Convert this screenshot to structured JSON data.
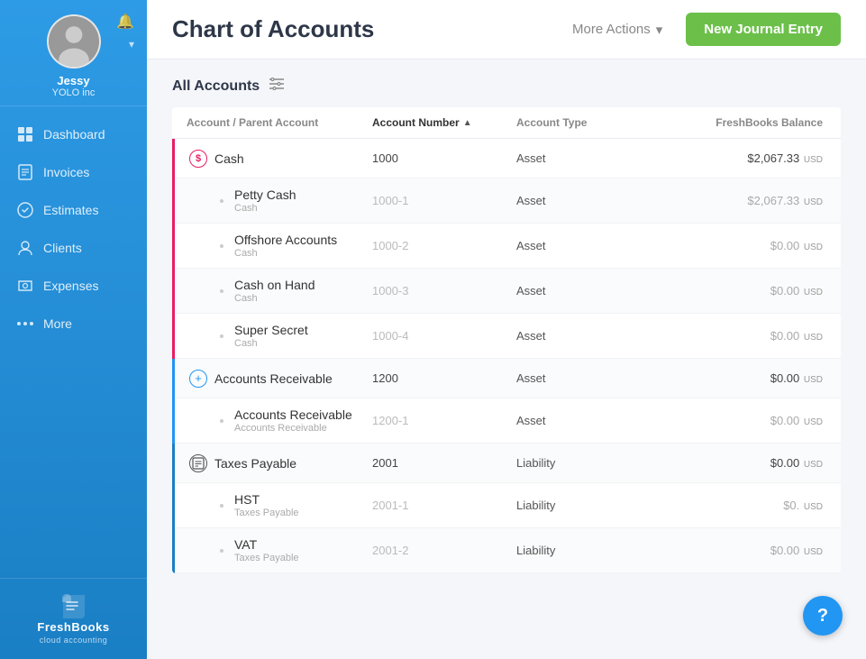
{
  "sidebar": {
    "user": {
      "name": "Jessy",
      "company": "YOLO inc"
    },
    "nav_items": [
      {
        "id": "dashboard",
        "label": "Dashboard",
        "icon": "dashboard"
      },
      {
        "id": "invoices",
        "label": "Invoices",
        "icon": "invoices"
      },
      {
        "id": "estimates",
        "label": "Estimates",
        "icon": "estimates"
      },
      {
        "id": "clients",
        "label": "Clients",
        "icon": "clients"
      },
      {
        "id": "expenses",
        "label": "Expenses",
        "icon": "expenses"
      },
      {
        "id": "more",
        "label": "More",
        "icon": "more"
      }
    ],
    "logo": {
      "text": "FreshBooks",
      "sub": "cloud accounting"
    }
  },
  "header": {
    "title": "Chart of Accounts",
    "more_actions_label": "More Actions",
    "new_journal_label": "New Journal Entry"
  },
  "accounts_section": {
    "all_accounts_label": "All Accounts",
    "table_headers": {
      "account": "Account / Parent Account",
      "number": "Account Number",
      "type": "Account Type",
      "balance": "FreshBooks Balance"
    },
    "rows": [
      {
        "id": "cash",
        "name": "Cash",
        "icon": "dollar",
        "number": "1000",
        "type": "Asset",
        "balance": "$2,067.33",
        "currency": "USD",
        "indent": 0,
        "accent": "pink"
      },
      {
        "id": "petty-cash",
        "name": "Petty Cash",
        "sub": "Cash",
        "icon": "indent",
        "number": "1000-1",
        "type": "Asset",
        "balance": "$2,067.33",
        "currency": "USD",
        "indent": 1,
        "accent": "pink"
      },
      {
        "id": "offshore",
        "name": "Offshore Accounts",
        "sub": "Cash",
        "icon": "indent",
        "number": "1000-2",
        "type": "Asset",
        "balance": "$0.00",
        "currency": "USD",
        "indent": 1,
        "accent": "pink"
      },
      {
        "id": "cash-on-hand",
        "name": "Cash on Hand",
        "sub": "Cash",
        "icon": "indent",
        "number": "1000-3",
        "type": "Asset",
        "balance": "$0.00",
        "currency": "USD",
        "indent": 1,
        "accent": "pink"
      },
      {
        "id": "super-secret",
        "name": "Super Secret",
        "sub": "Cash",
        "icon": "indent",
        "number": "1000-4",
        "type": "Asset",
        "balance": "$0.00",
        "currency": "USD",
        "indent": 1,
        "accent": "pink"
      },
      {
        "id": "ar",
        "name": "Accounts Receivable",
        "icon": "plus",
        "number": "1200",
        "type": "Asset",
        "balance": "$0.00",
        "currency": "USD",
        "indent": 0,
        "accent": "blue"
      },
      {
        "id": "ar-sub",
        "name": "Accounts Receivable",
        "sub": "Accounts Receivable",
        "icon": "indent",
        "number": "1200-1",
        "type": "Asset",
        "balance": "$0.00",
        "currency": "USD",
        "indent": 1,
        "accent": "blue"
      },
      {
        "id": "taxes-payable",
        "name": "Taxes Payable",
        "icon": "receipt",
        "number": "2001",
        "type": "Liability",
        "balance": "$0.00",
        "currency": "USD",
        "indent": 0,
        "accent": "none"
      },
      {
        "id": "hst",
        "name": "HST",
        "sub": "Taxes Payable",
        "icon": "indent",
        "number": "2001-1",
        "type": "Liability",
        "balance": "$0.",
        "currency": "USD",
        "indent": 1,
        "accent": "none"
      },
      {
        "id": "vat",
        "name": "VAT",
        "sub": "Taxes Payable",
        "icon": "indent",
        "number": "2001-2",
        "type": "Liability",
        "balance": "$0.00",
        "currency": "USD",
        "indent": 1,
        "accent": "none"
      }
    ]
  },
  "help_button": "?"
}
